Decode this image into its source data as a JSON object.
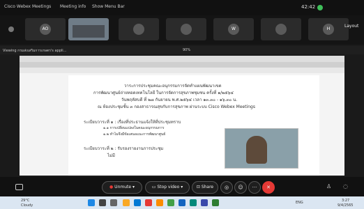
{
  "top": {
    "app_title": "Cisco Webex Meetings",
    "meeting_info": "Meeting info",
    "show_menu": "Show Menu Bar",
    "time": "42:42",
    "layout": "Layout"
  },
  "participants": [
    {
      "initials": "AO",
      "video": false
    },
    {
      "initials": "",
      "video": true
    },
    {
      "initials": "",
      "video": false
    },
    {
      "initials": "",
      "video": false
    },
    {
      "initials": "W",
      "video": false
    },
    {
      "initials": "",
      "video": false
    },
    {
      "initials": "H",
      "video": false
    }
  ],
  "share": {
    "viewing": "Viewing กรมส่งเสริมการเกษตร's appli...",
    "zoom": "90%"
  },
  "document": {
    "lines": [
      "วาระการประชุมคณะอนุกรรมการจัดทำแผนพัฒนาเขต",
      "การพัฒนาศูนย์ถ่ายทอดเทคโนโลยี ในการจัดการสุขภาพชุมชน ครั้งที่ ๑/๒๕๖๔",
      "วันพฤหัสบดี ที่ ๒๗ กันยายน พ.ศ.๒๕๖๔ เวลา ๑๓.๓๐ - ๑๖.๓๐ น.",
      "ณ ห้องประชุมชั้น ๓ กองสาธารณสุขกับการสุขภาพ ผ่านระบบ Cisco Webex Meetings",
      "ระเบียบวาระที่ ๑ : เรื่องที่ประธานแจ้งให้ที่ประชุมทราบ",
      "๑.๑ การเปลี่ยนแปลงในคณะอนุกรรมการ",
      "๑.๒ ทำไมจึงมีข้อเสนอแนะการพัฒนาศูนย์",
      "ระเบียบวาระที่ ๒ : รับรองรายงานการประชุม",
      "ไม่มี"
    ]
  },
  "controls": {
    "unmute": "Unmute",
    "stop_video": "Stop video",
    "share": "Share"
  },
  "taskbar": {
    "weather_temp": "29°C",
    "weather_text": "Cloudy",
    "lang": "ENG",
    "clock_time": "3:27",
    "clock_date": "9/4/2565"
  }
}
